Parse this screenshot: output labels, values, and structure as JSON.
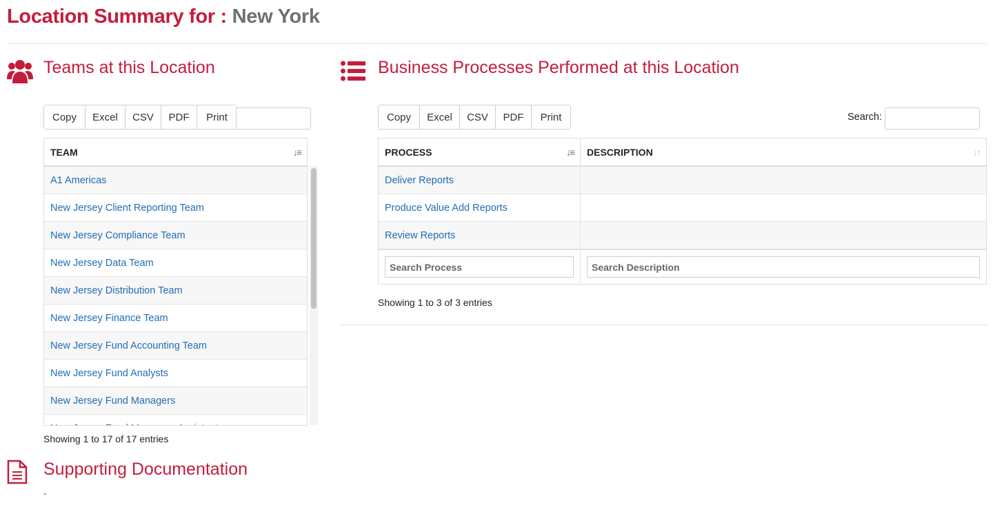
{
  "page": {
    "title_prefix": "Location Summary for :",
    "location": "New York"
  },
  "teams": {
    "heading": "Teams at this Location",
    "icon": "users-icon",
    "buttons": [
      "Copy",
      "Excel",
      "CSV",
      "PDF",
      "Print"
    ],
    "columns": [
      "TEAM"
    ],
    "rows": [
      "A1 Americas",
      "New Jersey Client Reporting Team",
      "New Jersey Compliance Team",
      "New Jersey Data Team",
      "New Jersey Distribution Team",
      "New Jersey Finance Team",
      "New Jersey Fund Accounting Team",
      "New Jersey Fund Analysts",
      "New Jersey Fund Managers",
      "New Jersey Fund Managers Assistants"
    ],
    "info": "Showing 1 to 17 of 17 entries"
  },
  "processes": {
    "heading": "Business Processes Performed at this Location",
    "icon": "list-icon",
    "buttons": [
      "Copy",
      "Excel",
      "CSV",
      "PDF",
      "Print"
    ],
    "search_label": "Search:",
    "columns": [
      "PROCESS",
      "DESCRIPTION"
    ],
    "rows": [
      {
        "process": "Deliver Reports",
        "description": ""
      },
      {
        "process": "Produce Value Add Reports",
        "description": ""
      },
      {
        "process": "Review Reports",
        "description": ""
      }
    ],
    "filter_process": "Search Process",
    "filter_description": "Search Description",
    "info": "Showing 1 to 3 of 3 entries"
  },
  "docs": {
    "heading": "Supporting Documentation",
    "icon": "document-icon",
    "content": "-"
  },
  "colors": {
    "accent": "#c41d3c",
    "link": "#1f6db5",
    "muted": "#6f6f6f"
  }
}
